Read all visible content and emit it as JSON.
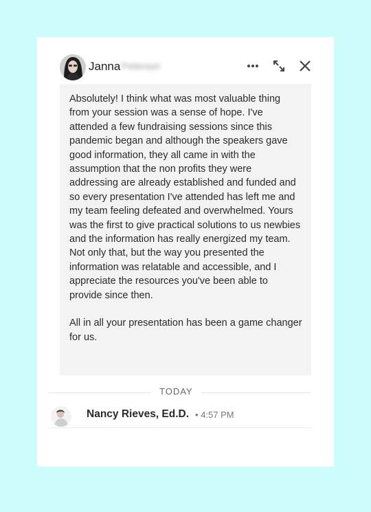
{
  "conversation": {
    "contact": {
      "first_name": "Janna",
      "last_name": "Peterson",
      "avatar": "profile-photo"
    },
    "header_actions": {
      "more_icon": "ellipsis-icon",
      "expand_icon": "expand-arrows-icon",
      "close_icon": "close-icon"
    },
    "message": {
      "paragraphs": [
        "Absolutely!  I think what was most valuable thing from your session was a sense of hope. I've attended a few fundraising sessions since this pandemic began and although the speakers gave good information, they all came in with the assumption that the non profits they were addressing are already established and funded and so every presentation I've attended has left me and my team feeling defeated and overwhelmed. Yours was the first to give practical solutions to us newbies and the information has really energized my team. Not only that, but the way you presented the information was relatable and accessible, and I appreciate the resources you've been able to provide since then.",
        "All in all your presentation has been a game changer for us."
      ]
    },
    "divider_label": "TODAY",
    "reply": {
      "sender_name": "Nancy Rieves, Ed.D.",
      "separator": "•",
      "time": "4:57 PM"
    }
  },
  "colors": {
    "page_background": "#ccfcfc",
    "card_background": "#ffffff",
    "message_background": "#f3f3f3"
  }
}
